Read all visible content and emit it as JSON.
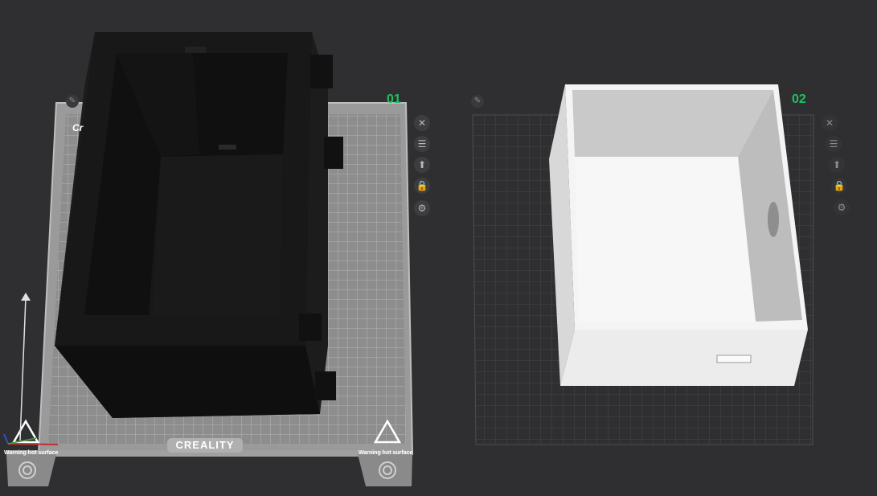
{
  "plates": [
    {
      "number": "01",
      "name_fragment": "Cr",
      "brand": "CREALITY",
      "warning_left": "Warning hot surface",
      "warning_right": "Warning hot surface"
    },
    {
      "number": "02"
    }
  ],
  "plate_tools": [
    {
      "name": "close",
      "glyph": "✕"
    },
    {
      "name": "arrange",
      "glyph": "☰"
    },
    {
      "name": "auto-orient",
      "glyph": "⬆"
    },
    {
      "name": "lock",
      "glyph": "🔒"
    },
    {
      "name": "settings",
      "glyph": "⚙"
    }
  ],
  "edit_glyph": "✎",
  "colors": {
    "background": "#2f2f31",
    "plate_number": "#20c060",
    "bed": "#8f8f8f",
    "model_dark": "#151515",
    "model_light": "#f2f2f2"
  }
}
